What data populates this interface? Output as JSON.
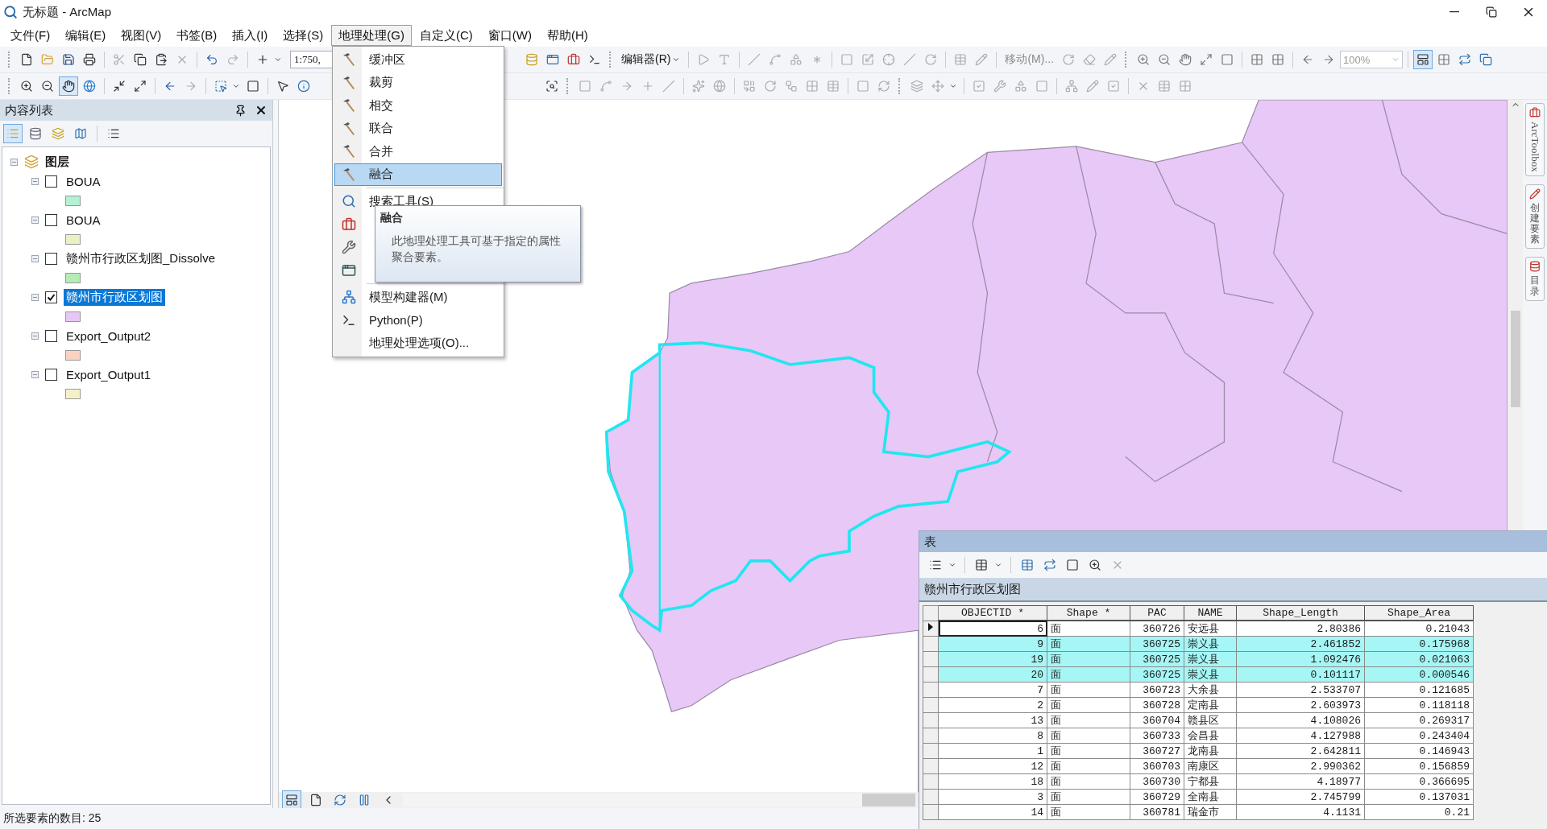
{
  "window": {
    "title": "无标题 - ArcMap"
  },
  "menu_bar": [
    {
      "label": "文件(F)",
      "selected": false
    },
    {
      "label": "编辑(E)",
      "selected": false
    },
    {
      "label": "视图(V)",
      "selected": false
    },
    {
      "label": "书签(B)",
      "selected": false
    },
    {
      "label": "插入(I)",
      "selected": false
    },
    {
      "label": "选择(S)",
      "selected": false
    },
    {
      "label": "地理处理(G)",
      "selected": true
    },
    {
      "label": "自定义(C)",
      "selected": false
    },
    {
      "label": "窗口(W)",
      "selected": false
    },
    {
      "label": "帮助(H)",
      "selected": false
    }
  ],
  "toolbar": {
    "scale": "1:750,",
    "editor_menu": "编辑器(R)",
    "move_tool": {
      "label": "移动(M)...",
      "disabled": true
    },
    "zoom_percent": "100%",
    "pan_tool": {
      "selected": true
    }
  },
  "geoprocessing_menu": {
    "groups": [
      [
        {
          "label": "缓冲区",
          "kind": "tool",
          "selected": false
        },
        {
          "label": "裁剪",
          "kind": "tool",
          "selected": false
        },
        {
          "label": "相交",
          "kind": "tool",
          "selected": false
        },
        {
          "label": "联合",
          "kind": "tool",
          "selected": false
        },
        {
          "label": "合并",
          "kind": "tool",
          "selected": false
        },
        {
          "label": "融合",
          "kind": "tool",
          "selected": true
        }
      ],
      [
        {
          "label": "搜索工具(S)",
          "kind": "search",
          "selected": false
        },
        {
          "kind": "toolbox",
          "selected": false
        },
        {
          "kind": "environment",
          "selected": false
        },
        {
          "kind": "results",
          "selected": false
        }
      ],
      [
        {
          "label": "模型构建器(M)",
          "kind": "model",
          "selected": false
        },
        {
          "label": "Python(P)",
          "kind": "python",
          "selected": false
        },
        {
          "label": "地理处理选项(O)...",
          "kind": "options",
          "selected": false
        }
      ]
    ]
  },
  "tooltip": {
    "title": "融合",
    "text": "此地理处理工具可基于指定的属性聚合要素。"
  },
  "table_of_contents": {
    "title": "内容列表",
    "list_by_drawing_order": {
      "selected": true
    },
    "layers": [
      {
        "label": "图层",
        "expanded": true,
        "children": [
          {
            "label": "BOUA",
            "checked": false,
            "selected": false,
            "expanded": true,
            "color": "#b4f0d2"
          },
          {
            "label": "BOUA",
            "checked": false,
            "selected": false,
            "expanded": true,
            "color": "#ecf0c8"
          },
          {
            "label": "赣州市行政区划图_Dissolve",
            "checked": false,
            "selected": false,
            "expanded": true,
            "color": "#b6ecb6"
          },
          {
            "label": "赣州市行政区划图",
            "checked": true,
            "selected": true,
            "expanded": true,
            "color": "#e6c8f5"
          },
          {
            "label": "Export_Output2",
            "checked": false,
            "selected": false,
            "expanded": true,
            "color": "#fad2c2"
          },
          {
            "label": "Export_Output1",
            "checked": false,
            "selected": false,
            "expanded": true,
            "color": "#f5f0c8"
          }
        ]
      }
    ]
  },
  "dock_tabs": [
    {
      "label": "ArcToolbox",
      "kind": "latin"
    },
    {
      "label": "创建要素",
      "kind": "cjk"
    },
    {
      "label": "目录",
      "kind": "cjk"
    }
  ],
  "status_bar": "所选要素的数目: 25",
  "attribute_table": {
    "title": "表",
    "layer": "赣州市行政区划图",
    "columns": [
      "OBJECTID *",
      "Shape *",
      "PAC",
      "NAME",
      "Shape_Length",
      "Shape_Area"
    ],
    "rows": [
      {
        "cells": [
          "6",
          "面",
          "360726",
          "安远县",
          "2.80386",
          "0.21043"
        ],
        "selected": false,
        "current": true
      },
      {
        "cells": [
          "9",
          "面",
          "360725",
          "崇义县",
          "2.461852",
          "0.175968"
        ],
        "selected": true,
        "current": false
      },
      {
        "cells": [
          "19",
          "面",
          "360725",
          "崇义县",
          "1.092476",
          "0.021063"
        ],
        "selected": true,
        "current": false
      },
      {
        "cells": [
          "20",
          "面",
          "360725",
          "崇义县",
          "0.101117",
          "0.000546"
        ],
        "selected": true,
        "current": false
      },
      {
        "cells": [
          "7",
          "面",
          "360723",
          "大余县",
          "2.533707",
          "0.121685"
        ],
        "selected": false,
        "current": false
      },
      {
        "cells": [
          "2",
          "面",
          "360728",
          "定南县",
          "2.603973",
          "0.118118"
        ],
        "selected": false,
        "current": false
      },
      {
        "cells": [
          "13",
          "面",
          "360704",
          "赣县区",
          "4.108026",
          "0.269317"
        ],
        "selected": false,
        "current": false
      },
      {
        "cells": [
          "8",
          "面",
          "360733",
          "会昌县",
          "4.127988",
          "0.243404"
        ],
        "selected": false,
        "current": false
      },
      {
        "cells": [
          "1",
          "面",
          "360727",
          "龙南县",
          "2.642811",
          "0.146943"
        ],
        "selected": false,
        "current": false
      },
      {
        "cells": [
          "12",
          "面",
          "360703",
          "南康区",
          "2.990362",
          "0.156859"
        ],
        "selected": false,
        "current": false
      },
      {
        "cells": [
          "18",
          "面",
          "360730",
          "宁都县",
          "4.18977",
          "0.366695"
        ],
        "selected": false,
        "current": false
      },
      {
        "cells": [
          "3",
          "面",
          "360729",
          "全南县",
          "2.745799",
          "0.137031"
        ],
        "selected": false,
        "current": false
      },
      {
        "cells": [
          "14",
          "面",
          "360781",
          "瑞金市",
          "4.1131",
          "0.21"
        ],
        "selected": false,
        "current": false
      }
    ]
  }
}
